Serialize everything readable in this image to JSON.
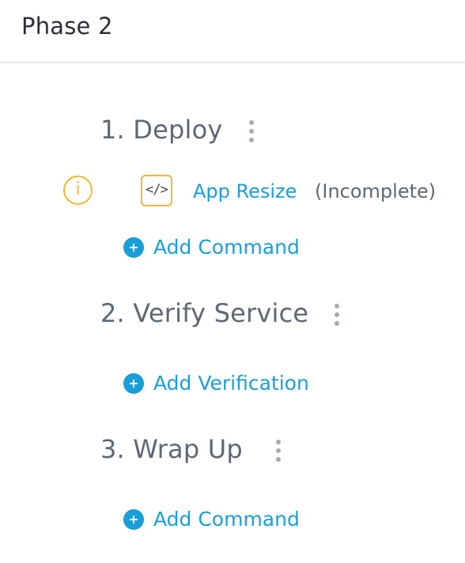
{
  "header": {
    "title": "Phase 2"
  },
  "steps": [
    {
      "title": "1. Deploy",
      "commands": [
        {
          "name": "App Resize",
          "status": "(Incomplete)",
          "warning_icon": "info-icon",
          "type_icon": "code-icon",
          "type_icon_glyph": "</>"
        }
      ],
      "add_label": "Add Command"
    },
    {
      "title": "2. Verify Service",
      "commands": [],
      "add_label": "Add Verification"
    },
    {
      "title": "3. Wrap Up",
      "commands": [],
      "add_label": "Add Command"
    }
  ],
  "icons": {
    "info_glyph": "i",
    "menu_icon": "kebab-menu-icon",
    "add_icon": "plus-circle-icon"
  },
  "colors": {
    "link": "#1a9ed8",
    "warning": "#f5b731",
    "step_text": "#5e6775",
    "menu_dots": "#a6abb4"
  }
}
